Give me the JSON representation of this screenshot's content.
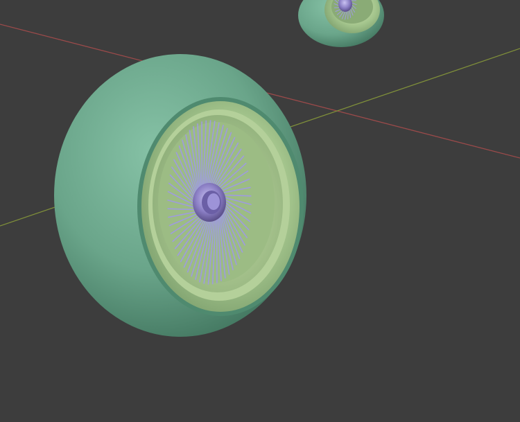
{
  "viewport": {
    "background_color": "#3d3d3d",
    "x_axis_color": "#9a4a4a",
    "y_axis_color": "#7f8f3a"
  },
  "wheel_colors": {
    "tire": "#6aa58a",
    "tire_shadow": "#3c6f59",
    "rim": "#a3c48c",
    "rim_shadow": "#6f9262",
    "spoke": "#9f9be0",
    "hub": "#8a7ec4"
  }
}
